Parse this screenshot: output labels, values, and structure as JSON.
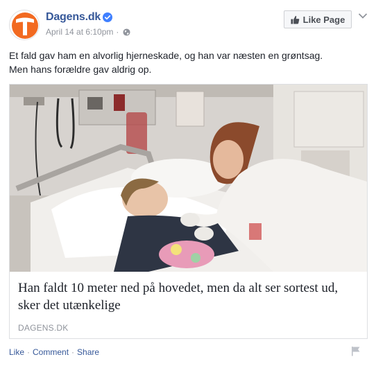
{
  "header": {
    "page_name": "Dagens.dk",
    "timestamp": "April 14 at 6:10pm",
    "separator": "·",
    "like_page_label": "Like Page"
  },
  "post": {
    "text_line1": "Et fald gav ham en alvorlig hjerneskade, og han var næsten en grøntsag.",
    "text_line2": "Men hans forældre gav aldrig op."
  },
  "link_card": {
    "title": "Han faldt 10 meter ned på hovedet, men da alt ser sortest ud, sker det utænkelige",
    "domain": "DAGENS.DK"
  },
  "actions": {
    "like": "Like",
    "comment": "Comment",
    "share": "Share",
    "sep": "·"
  },
  "colors": {
    "brand_orange": "#f26a21",
    "link_blue": "#365899",
    "verified_blue": "#4080ff",
    "muted_gray": "#90949c"
  },
  "icons": [
    "verified-badge-icon",
    "globe-icon",
    "thumbs-up-icon",
    "chevron-down-icon",
    "flag-icon"
  ]
}
